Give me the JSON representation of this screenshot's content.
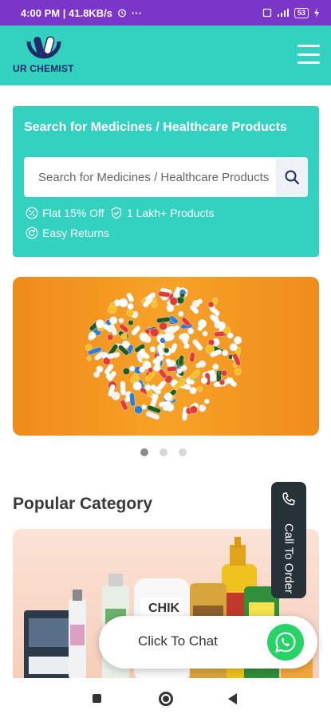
{
  "status_bar": {
    "time_info": "4:00 PM | 41.8KB/s",
    "battery": "53"
  },
  "header": {
    "logo_text": "UR CHEMIST",
    "menu_icon": "hamburger-menu-icon"
  },
  "search": {
    "title": "Search for Medicines / Healthcare Products",
    "placeholder": "Search for Medicines / Healthcare Products",
    "button_icon": "search-icon"
  },
  "features": [
    {
      "label": "Flat 15% Off",
      "icon": "discount-icon"
    },
    {
      "label": "1 Lakh+ Products",
      "icon": "shield-check-icon"
    },
    {
      "label": "Easy Returns",
      "icon": "return-icon"
    }
  ],
  "carousel": {
    "slide_count": 3,
    "active_index": 0
  },
  "popular_category": {
    "title": "Popular Category"
  },
  "floating": {
    "call_label": "Call To Order",
    "chat_label": "Click To Chat"
  },
  "colors": {
    "status_bar": "#7b35c9",
    "brand_teal": "#33d1c0",
    "brand_navy": "#1f2a68",
    "banner_orange": "#f39a22",
    "call_tab_bg": "#263238",
    "whatsapp_green": "#25d366"
  }
}
